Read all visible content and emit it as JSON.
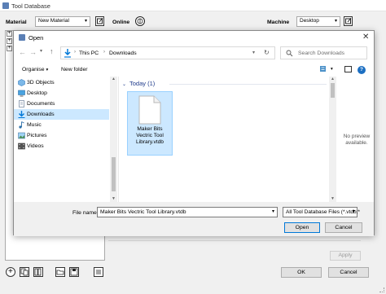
{
  "parent": {
    "title": "Tool Database",
    "material_label": "Material",
    "material_value": "New Material",
    "online_label": "Online",
    "machine_label": "Machine",
    "machine_value": "Desktop",
    "apply_label": "Apply",
    "ok_label": "OK",
    "cancel_label": "Cancel"
  },
  "dialog": {
    "title": "Open",
    "breadcrumb": [
      "This PC",
      "Downloads"
    ],
    "search_placeholder": "Search Downloads",
    "organise_label": "Organise",
    "new_folder_label": "New folder",
    "nav_items": [
      {
        "label": "3D Objects",
        "icon": "3d-objects-icon"
      },
      {
        "label": "Desktop",
        "icon": "desktop-icon"
      },
      {
        "label": "Documents",
        "icon": "documents-icon"
      },
      {
        "label": "Downloads",
        "icon": "downloads-icon"
      },
      {
        "label": "Music",
        "icon": "music-icon"
      },
      {
        "label": "Pictures",
        "icon": "pictures-icon"
      },
      {
        "label": "Videos",
        "icon": "videos-icon"
      }
    ],
    "group_header": "Today (1)",
    "file_name": "Maker Bits Vectric Tool Library.vtdb",
    "file_name_lines": [
      "Maker Bits",
      "Vectric Tool",
      "Library.vtdb"
    ],
    "preview_text": "No preview available.",
    "file_name_label": "File name:",
    "file_name_value": "Maker Bits Vectric Tool Library.vtdb",
    "file_type_value": "All Tool Database Files (*.vtdb;*",
    "open_label": "Open",
    "cancel_label": "Cancel"
  },
  "colors": {
    "selection": "#cce8ff",
    "selection_border": "#99d1ff",
    "accent": "#0078d7"
  }
}
